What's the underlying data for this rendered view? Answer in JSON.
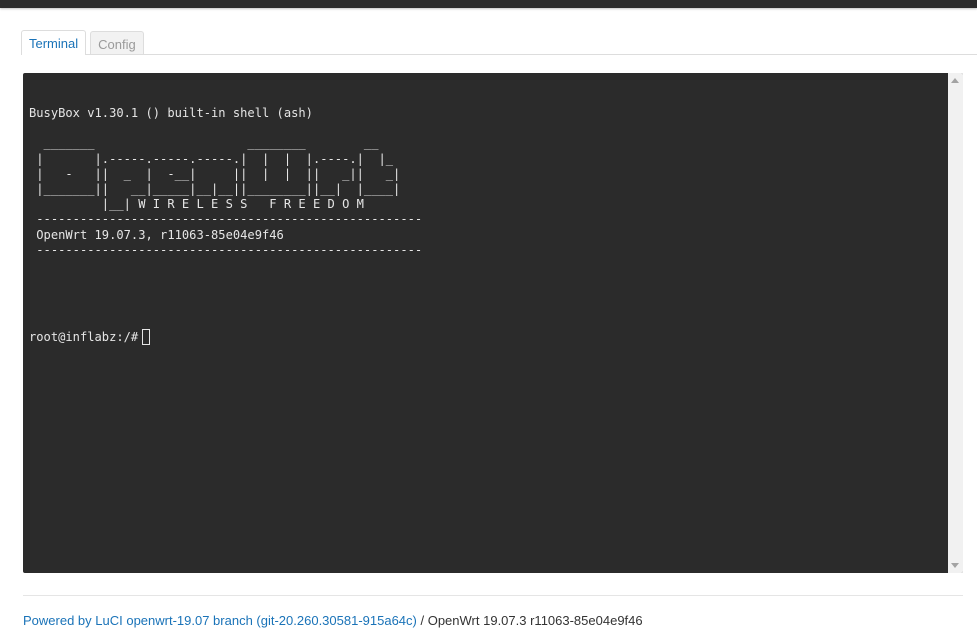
{
  "tabs": [
    {
      "label": "Terminal",
      "active": true
    },
    {
      "label": "Config",
      "active": false
    }
  ],
  "terminal": {
    "output": "BusyBox v1.30.1 () built-in shell (ash)\n\n  _______                     ________        __\n |       |.-----.-----.-----.|  |  |  |.----.|  |_\n |   -   ||  _  |  -__|     ||  |  |  ||   _||   _|\n |_______||   __|_____|__|__||________||__|  |____|\n          |__| W I R E L E S S   F R E E D O M\n -----------------------------------------------------\n OpenWrt 19.07.3, r11063-85e04e9f46\n -----------------------------------------------------",
    "prompt": "root@inflabz:/#"
  },
  "footer": {
    "link_text": "Powered by LuCI openwrt-19.07 branch (git-20.260.30581-915a64c)",
    "separator": " / ",
    "version_text": "OpenWrt 19.07.3 r11063-85e04e9f46"
  },
  "colors": {
    "accent": "#1a73b8",
    "terminal_bg": "#2b2b2b",
    "terminal_fg": "#e6e6e6"
  }
}
